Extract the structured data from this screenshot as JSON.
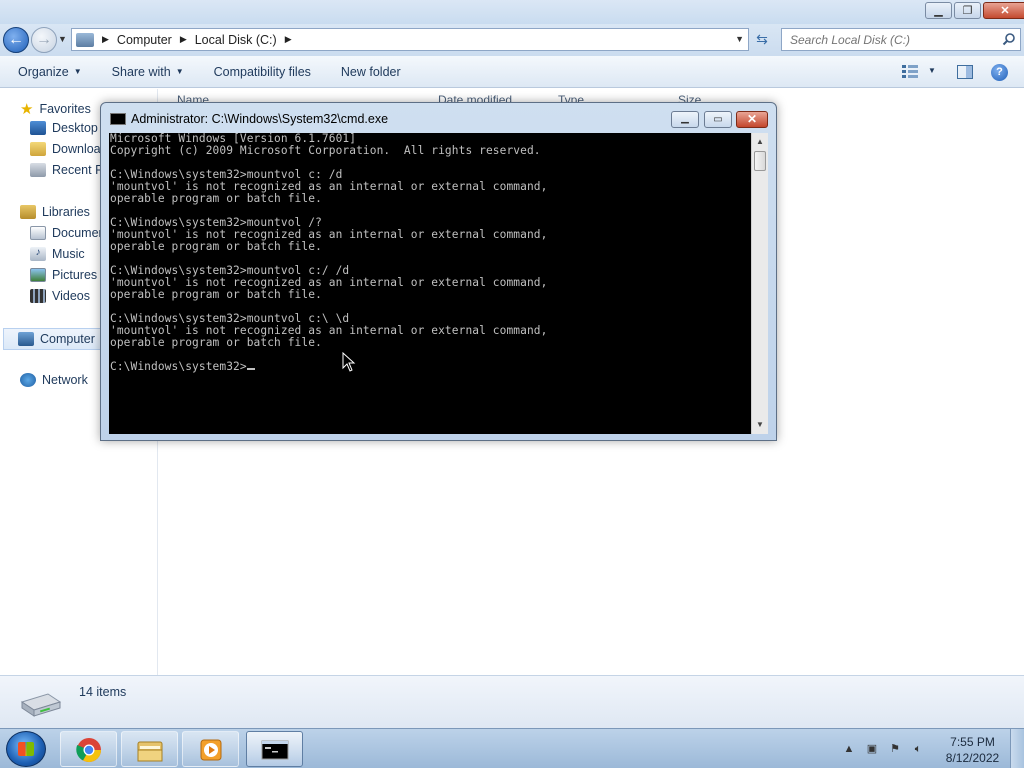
{
  "explorer": {
    "address_crumbs": [
      "Computer",
      "Local Disk (C:)"
    ],
    "search_placeholder": "Search Local Disk (C:)",
    "toolbar": {
      "organize": "Organize",
      "share_with": "Share with",
      "compatibility": "Compatibility files",
      "new_folder": "New folder"
    },
    "nav": {
      "favorites": "Favorites",
      "desktop": "Desktop",
      "downloads": "Downloa",
      "recent": "Recent Pl",
      "libraries": "Libraries",
      "documents": "Documer",
      "music": "Music",
      "pictures": "Pictures",
      "videos": "Videos",
      "computer": "Computer",
      "network": "Network"
    },
    "columns": [
      "Name",
      "Date modified",
      "Type",
      "Size"
    ],
    "status": {
      "item_count": "14 items"
    }
  },
  "cmd": {
    "title": "Administrator: C:\\Windows\\System32\\cmd.exe",
    "console_lines": [
      "Microsoft Windows [Version 6.1.7601]",
      "Copyright (c) 2009 Microsoft Corporation.  All rights reserved.",
      "",
      "C:\\Windows\\system32>mountvol c: /d",
      "'mountvol' is not recognized as an internal or external command,",
      "operable program or batch file.",
      "",
      "C:\\Windows\\system32>mountvol /?",
      "'mountvol' is not recognized as an internal or external command,",
      "operable program or batch file.",
      "",
      "C:\\Windows\\system32>mountvol c:/ /d",
      "'mountvol' is not recognized as an internal or external command,",
      "operable program or batch file.",
      "",
      "C:\\Windows\\system32>mountvol c:\\ \\d",
      "'mountvol' is not recognized as an internal or external command,",
      "operable program or batch file.",
      "",
      "C:\\Windows\\system32>"
    ]
  },
  "taskbar": {
    "time": "7:55 PM",
    "date": "8/12/2022"
  },
  "colors": {
    "console_bg": "#000000",
    "console_fg": "#c0c0c0",
    "accent": "#1f5fb8"
  }
}
